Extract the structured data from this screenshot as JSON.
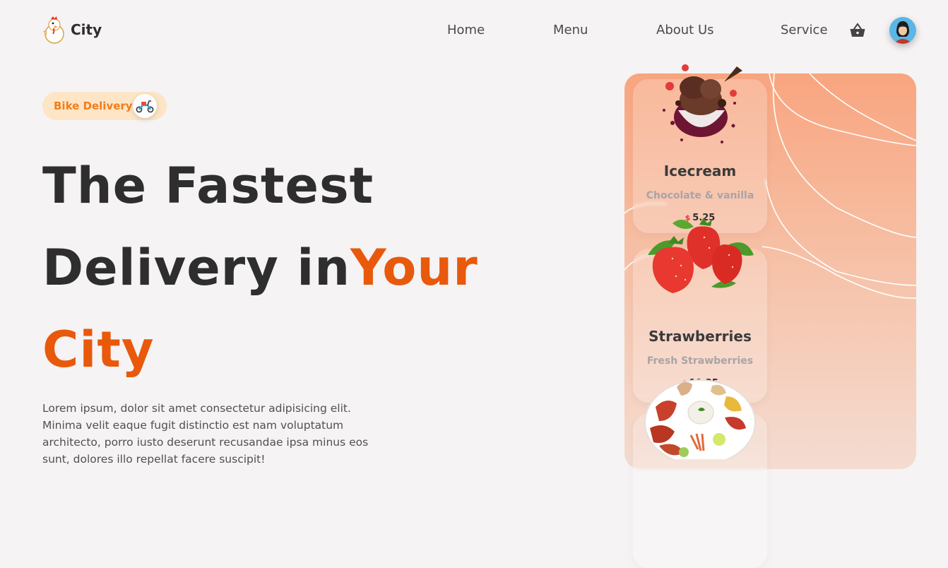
{
  "brand": {
    "name": "City",
    "logo_icon": "chicken-mascot-icon"
  },
  "nav": {
    "items": [
      "Home",
      "Menu",
      "About Us",
      "Service"
    ],
    "cart_icon": "basket-icon",
    "avatar_icon": "user-avatar"
  },
  "hero": {
    "badge_label": "Bike Delivery",
    "badge_icon": "scooter-icon",
    "headline_line1": "The Fastest",
    "headline_line2a": "Delivery in",
    "headline_line2b": "Your",
    "headline_line3": "City",
    "description": "Lorem ipsum, dolor sit amet consectetur adipisicing elit. Minima velit eaque fugit distinctio est nam voluptatum architecto, porro iusto deserunt recusandae ipsa minus eos sunt, dolores illo repellat facere suscipit!"
  },
  "cards": [
    {
      "title": "Icecream",
      "subtitle": "Chocolate & vanilla",
      "currency": "$",
      "price": "5.25",
      "image_icon": "icecream-image"
    },
    {
      "title": "Strawberries",
      "subtitle": "Fresh Strawberries",
      "currency": "$",
      "price": "10.25",
      "image_icon": "strawberry-image"
    },
    {
      "title": "",
      "subtitle": "",
      "currency": "",
      "price": "",
      "image_icon": "chicken-platter-image"
    }
  ],
  "colors": {
    "accent": "#e8590c",
    "badge_bg": "#fde5c6",
    "badge_text": "#f07d1b",
    "panel_top": "#f8a57f",
    "panel_bottom": "#f4dcd1"
  }
}
